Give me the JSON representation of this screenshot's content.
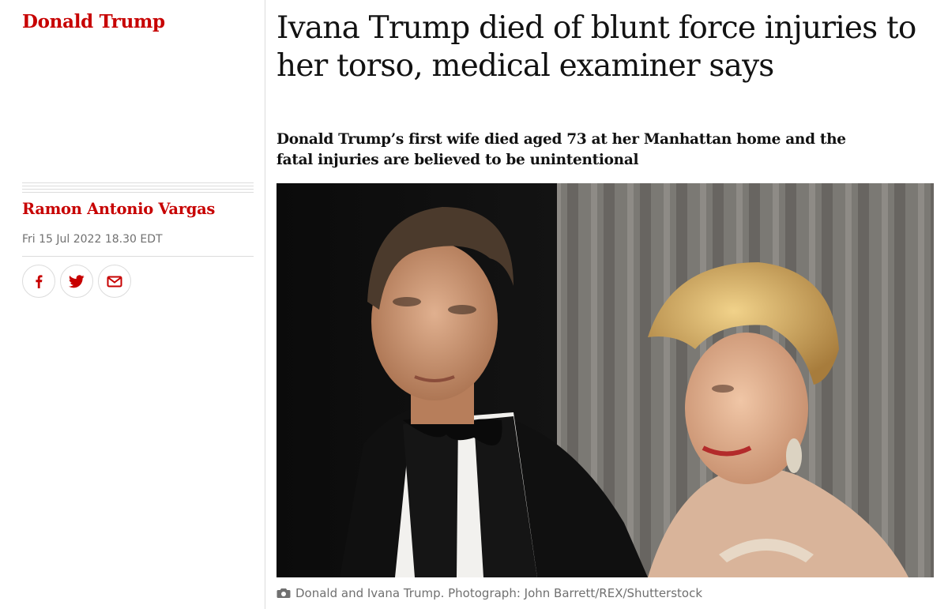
{
  "section": {
    "label": "Donald Trump",
    "color": "#c70000"
  },
  "article": {
    "headline": "Ivana Trump died of blunt force injuries to her torso, medical examiner says",
    "standfirst": "Donald Trump’s first wife died aged 73 at her Manhattan home and the fatal injuries are believed to be unintentional",
    "byline": "Ramon Antonio Vargas",
    "dateline": "Fri 15 Jul 2022 18.30 EDT"
  },
  "share": [
    {
      "icon": "facebook-icon"
    },
    {
      "icon": "twitter-icon"
    },
    {
      "icon": "email-icon"
    }
  ],
  "image": {
    "caption": "Donald and Ivana Trump. Photograph: John Barrett/REX/Shutterstock",
    "caption_icon": "camera-icon"
  }
}
